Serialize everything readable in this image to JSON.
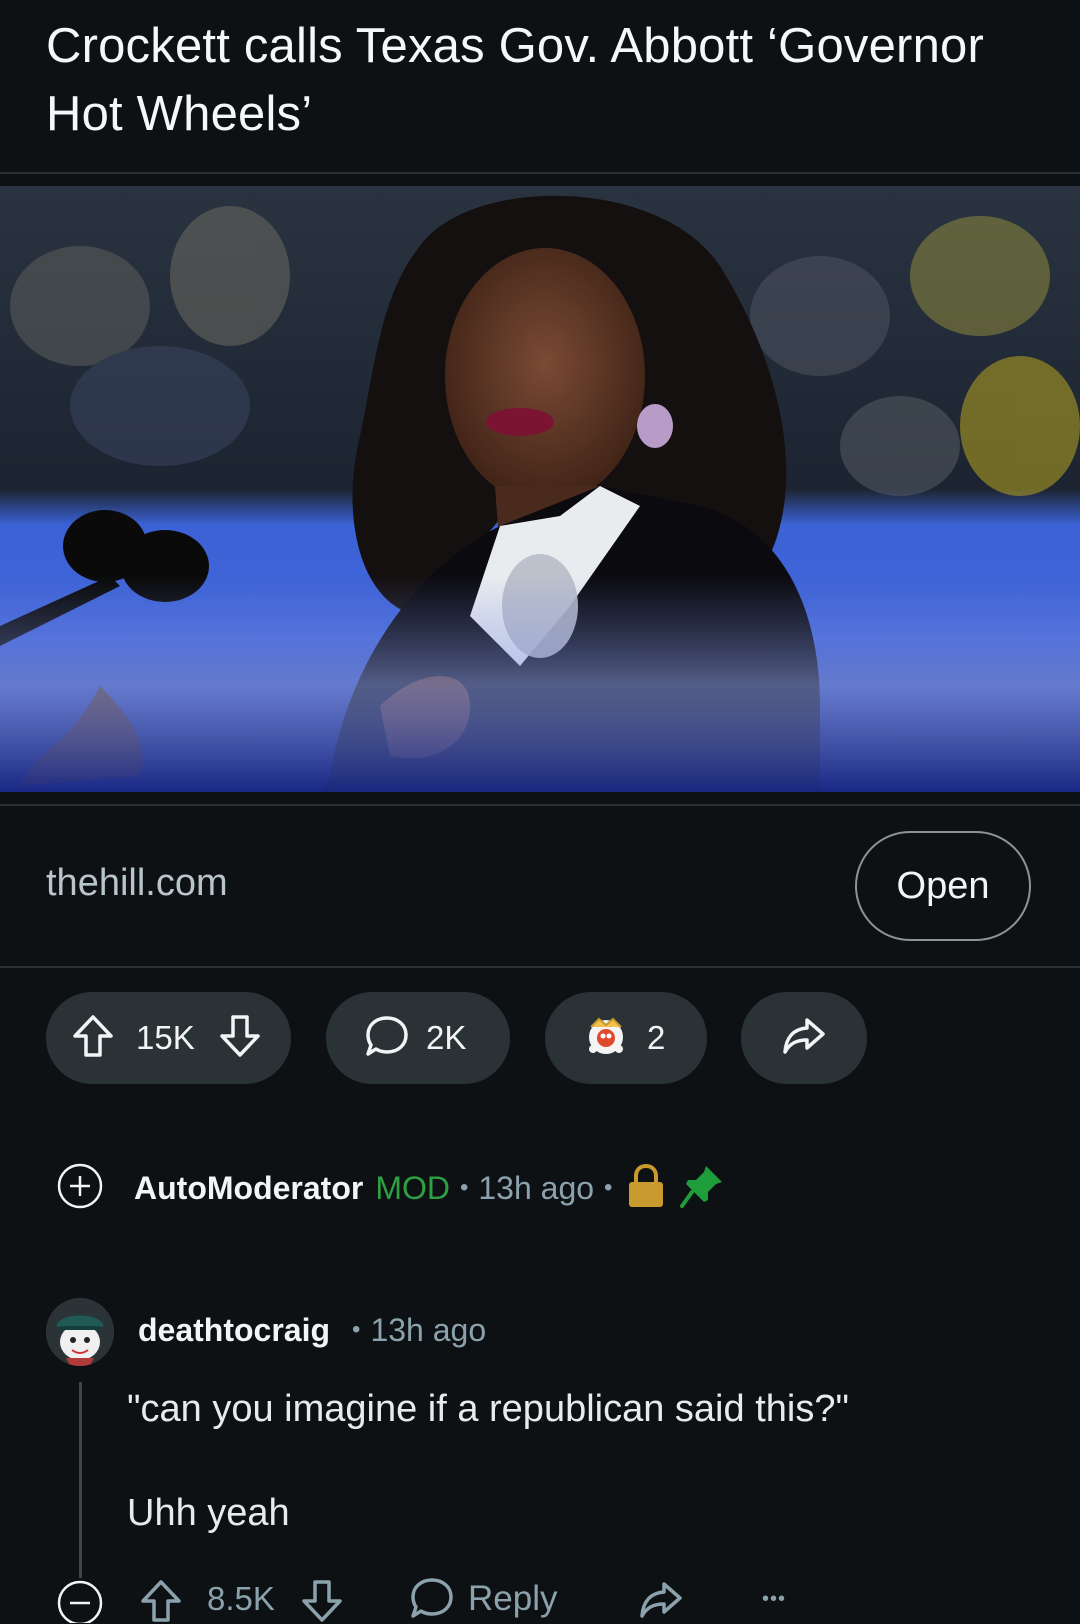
{
  "post": {
    "title": "Crockett calls Texas Gov. Abbott ‘Governor Hot Wheels’",
    "domain": "thehill.com",
    "open_label": "Open"
  },
  "actions": {
    "votes": "15K",
    "comments": "2K",
    "awards": "2"
  },
  "comments": {
    "pinned": {
      "author": "AutoModerator",
      "role": "MOD",
      "time": "13h ago"
    },
    "first": {
      "author": "deathtocraig",
      "time": "13h ago",
      "line1": "\"can you imagine if a republican said this?\"",
      "line2": "Uhh yeah",
      "votes": "8.5K",
      "reply_label": "Reply",
      "more_label": "•••"
    }
  },
  "colors": {
    "background": "#0e1113",
    "pill": "#2a3236",
    "mod_green": "#2ea043",
    "lock_gold": "#c99a2e",
    "pin_green": "#1f9d3a"
  },
  "icons": [
    "upvote-icon",
    "downvote-icon",
    "comment-icon",
    "award-icon",
    "share-icon",
    "expand-icon",
    "collapse-icon",
    "lock-icon",
    "pin-icon",
    "reply-icon",
    "more-icon"
  ]
}
